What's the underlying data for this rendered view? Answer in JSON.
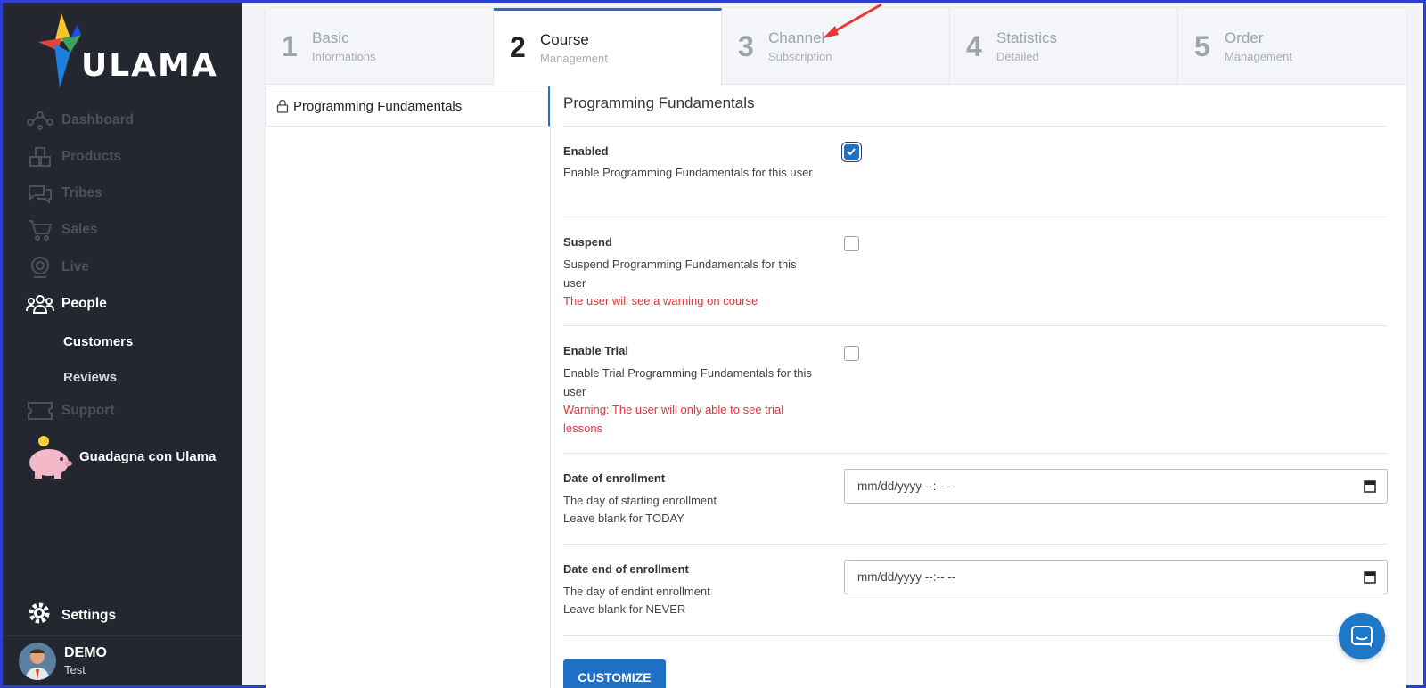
{
  "brand": {
    "name": "ULAMA"
  },
  "sidebar": {
    "items": [
      {
        "label": "Dashboard",
        "icon": "nodes-icon"
      },
      {
        "label": "Products",
        "icon": "boxes-icon"
      },
      {
        "label": "Tribes",
        "icon": "chat-bubbles-icon"
      },
      {
        "label": "Sales",
        "icon": "cart-icon"
      },
      {
        "label": "Live",
        "icon": "webcam-icon"
      },
      {
        "label": "People",
        "icon": "users-icon"
      }
    ],
    "subitems": [
      {
        "label": "Customers"
      },
      {
        "label": "Reviews"
      }
    ],
    "support": {
      "label": "Support",
      "icon": "ticket-icon"
    },
    "promo": {
      "label": "Guadagna con Ulama",
      "icon": "piggy-bank-icon"
    },
    "settings": {
      "label": "Settings",
      "icon": "gear-icon"
    },
    "user": {
      "name": "DEMO",
      "role": "Test"
    }
  },
  "steps": [
    {
      "num": "1",
      "title": "Basic",
      "subtitle": "Informations"
    },
    {
      "num": "2",
      "title": "Course",
      "subtitle": "Management"
    },
    {
      "num": "3",
      "title": "Channel",
      "subtitle": "Subscription"
    },
    {
      "num": "4",
      "title": "Statistics",
      "subtitle": "Detailed"
    },
    {
      "num": "5",
      "title": "Order",
      "subtitle": "Management"
    }
  ],
  "course_tab": {
    "label": "Programming Fundamentals"
  },
  "content": {
    "title": "Programming Fundamentals",
    "enabled": {
      "label": "Enabled",
      "desc": "Enable Programming Fundamentals for this user",
      "checked": true
    },
    "suspend": {
      "label": "Suspend",
      "desc": "Suspend Programming Fundamentals for this user",
      "warning": "The user will see a warning on course",
      "checked": false
    },
    "trial": {
      "label": "Enable Trial",
      "desc": "Enable Trial Programming Fundamentals for this user",
      "warning": "Warning: The user will only able to see trial lessons",
      "checked": false
    },
    "date_start": {
      "label": "Date of enrollment",
      "desc_line1": "The day of starting enrollment",
      "desc_line2": "Leave blank for TODAY",
      "placeholder": "mm/dd/yyyy --:-- --"
    },
    "date_end": {
      "label": "Date end of enrollment",
      "desc_line1": "The day of endint enrollment",
      "desc_line2": "Leave blank for NEVER",
      "placeholder": "mm/dd/yyyy --:-- --"
    },
    "customize_button": "CUSTOMIZE"
  },
  "colors": {
    "accent": "#1f6fc4",
    "sidebar_bg": "#242730",
    "warning": "#e4343a",
    "annotation_arrow": "#e53935"
  }
}
